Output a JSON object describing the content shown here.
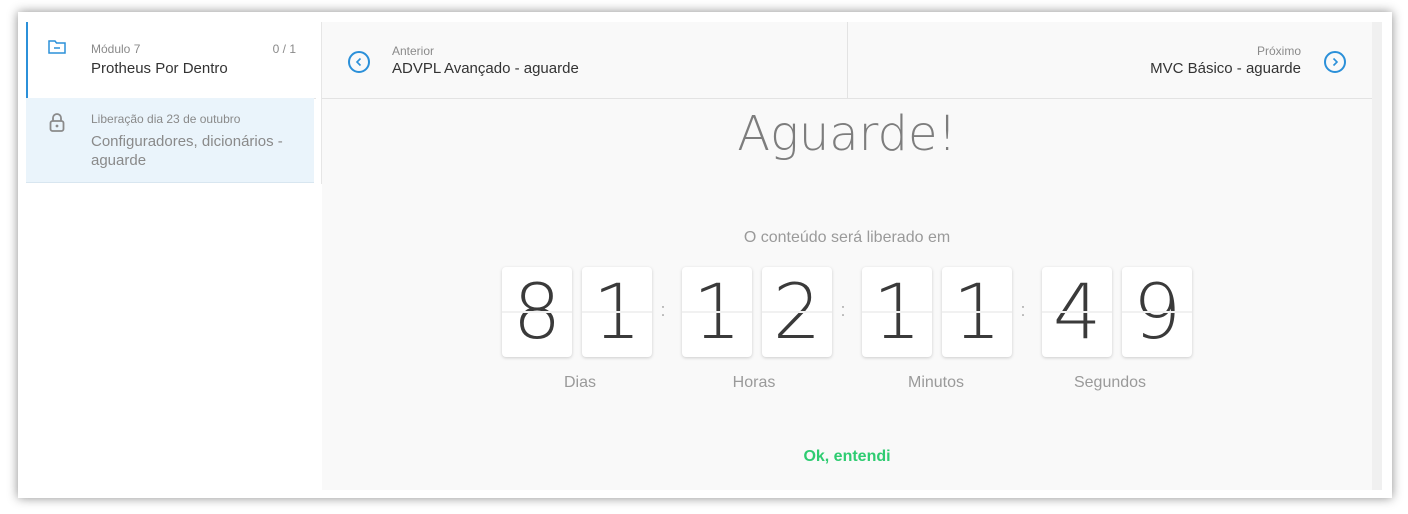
{
  "sidebar": {
    "module": {
      "subtitle": "Módulo 7",
      "count": "0 / 1",
      "title": "Protheus Por Dentro"
    },
    "lesson": {
      "subtitle": "Liberação dia 23 de outubro",
      "title": "Configuradores, dicionários - aguarde"
    }
  },
  "nav": {
    "prev": {
      "label": "Anterior",
      "title": "ADVPL Avançado - aguarde"
    },
    "next": {
      "label": "Próximo",
      "title": "MVC Básico - aguarde"
    }
  },
  "countdown": {
    "heading": "Aguarde!",
    "subtitle": "O conteúdo será liberado em",
    "digits": {
      "days": [
        "8",
        "1"
      ],
      "hours": [
        "1",
        "2"
      ],
      "minutes": [
        "1",
        "1"
      ],
      "seconds": [
        "4",
        "9"
      ]
    },
    "separator": ":",
    "units": {
      "days": "Dias",
      "hours": "Horas",
      "minutes": "Minutos",
      "seconds": "Segundos"
    },
    "ok_label": "Ok, entendi"
  },
  "colors": {
    "accent": "#2b90d9",
    "ok": "#2ecc71",
    "lesson_bg": "#eaf4fb"
  }
}
